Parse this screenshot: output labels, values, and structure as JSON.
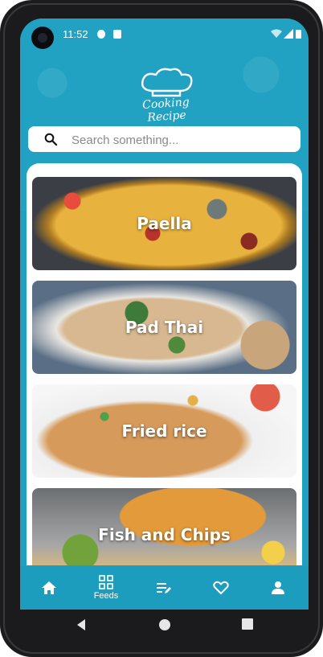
{
  "status_bar": {
    "time": "11:52"
  },
  "app": {
    "logo_text": "Cooking Recipe"
  },
  "search": {
    "placeholder": "Search something..."
  },
  "recipes": [
    {
      "name": "Paella"
    },
    {
      "name": "Pad Thai"
    },
    {
      "name": "Fried rice"
    },
    {
      "name": "Fish and Chips"
    }
  ],
  "bottom_nav": {
    "items": [
      {
        "icon": "home-icon",
        "label": ""
      },
      {
        "icon": "grid-icon",
        "label": "Feeds"
      },
      {
        "icon": "list-edit-icon",
        "label": ""
      },
      {
        "icon": "heart-icon",
        "label": ""
      },
      {
        "icon": "person-icon",
        "label": ""
      }
    ]
  },
  "colors": {
    "primary": "#21a2c2",
    "nav": "#1d9dbd",
    "device": "#1b1b1d"
  }
}
